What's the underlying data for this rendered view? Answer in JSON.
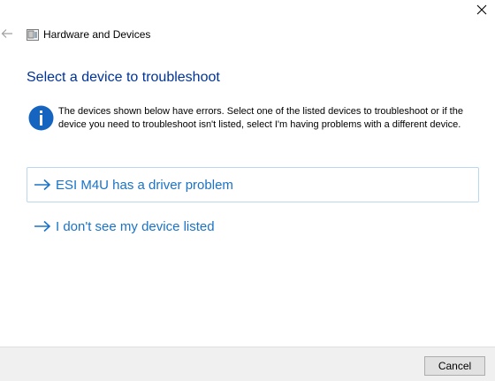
{
  "window": {
    "title": "Hardware and Devices",
    "close_icon": "close-icon",
    "back_icon": "back-arrow-icon",
    "app_icon": "hardware-devices-icon"
  },
  "main": {
    "heading": "Select a device to troubleshoot",
    "info_icon": "info-icon",
    "info_text": "The devices shown below have errors. Select one of the listed devices to troubleshoot or if the device you need to troubleshoot isn't listed, select I'm having problems with a different device.",
    "options": [
      {
        "label": "ESI M4U has a driver problem",
        "icon": "arrow-right-icon"
      },
      {
        "label": "I don't see my device listed",
        "icon": "arrow-right-icon"
      }
    ]
  },
  "footer": {
    "cancel_label": "Cancel"
  },
  "colors": {
    "heading": "#003399",
    "link": "#1a73c8",
    "info_blue": "#1565c0",
    "footer_bg": "#f0f0f0"
  }
}
